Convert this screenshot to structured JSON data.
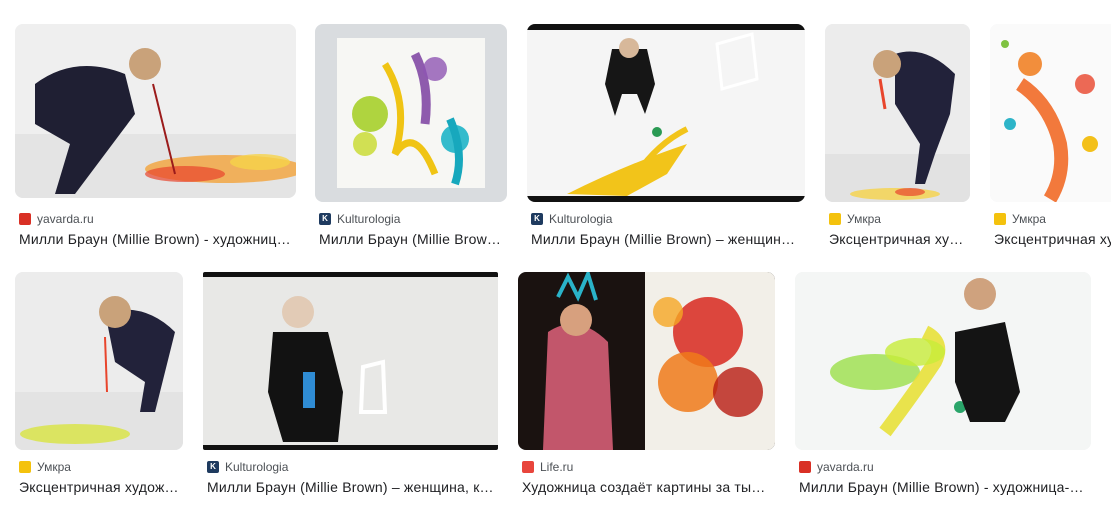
{
  "results": [
    {
      "source": "yavarda.ru",
      "title": "Милли Браун (Millie Brown) - художниц…",
      "favicon": "yavarda-icon"
    },
    {
      "source": "Kulturologia",
      "title": "Милли Браун (Millie Brow…",
      "favicon": "kulturologia-icon"
    },
    {
      "source": "Kulturologia",
      "title": "Милли Браун (Millie Brown) – женщин…",
      "favicon": "kulturologia-icon"
    },
    {
      "source": "Умкра",
      "title": "Эксцентричная ху…",
      "favicon": "umkra-icon"
    },
    {
      "source": "Умкра",
      "title": "Эксцентричная ху",
      "favicon": "umkra-icon"
    },
    {
      "source": "Умкра",
      "title": "Эксцентричная худож…",
      "favicon": "umkra-icon"
    },
    {
      "source": "Kulturologia",
      "title": "Милли Браун (Millie Brown) – женщина, к…",
      "favicon": "kulturologia-icon"
    },
    {
      "source": "Life.ru",
      "title": "Художница создаёт картины за ты…",
      "favicon": "life-ru-icon"
    },
    {
      "source": "yavarda.ru",
      "title": "Милли Браун (Millie Brown) - художница-…",
      "favicon": "yavarda-icon"
    }
  ],
  "colors": {
    "title": "#202124",
    "source": "#4d5156",
    "kulturologia": "#1e3a5f",
    "yavarda": "#d93025",
    "umkra": "#f4c20d",
    "life": "#e8453c"
  }
}
